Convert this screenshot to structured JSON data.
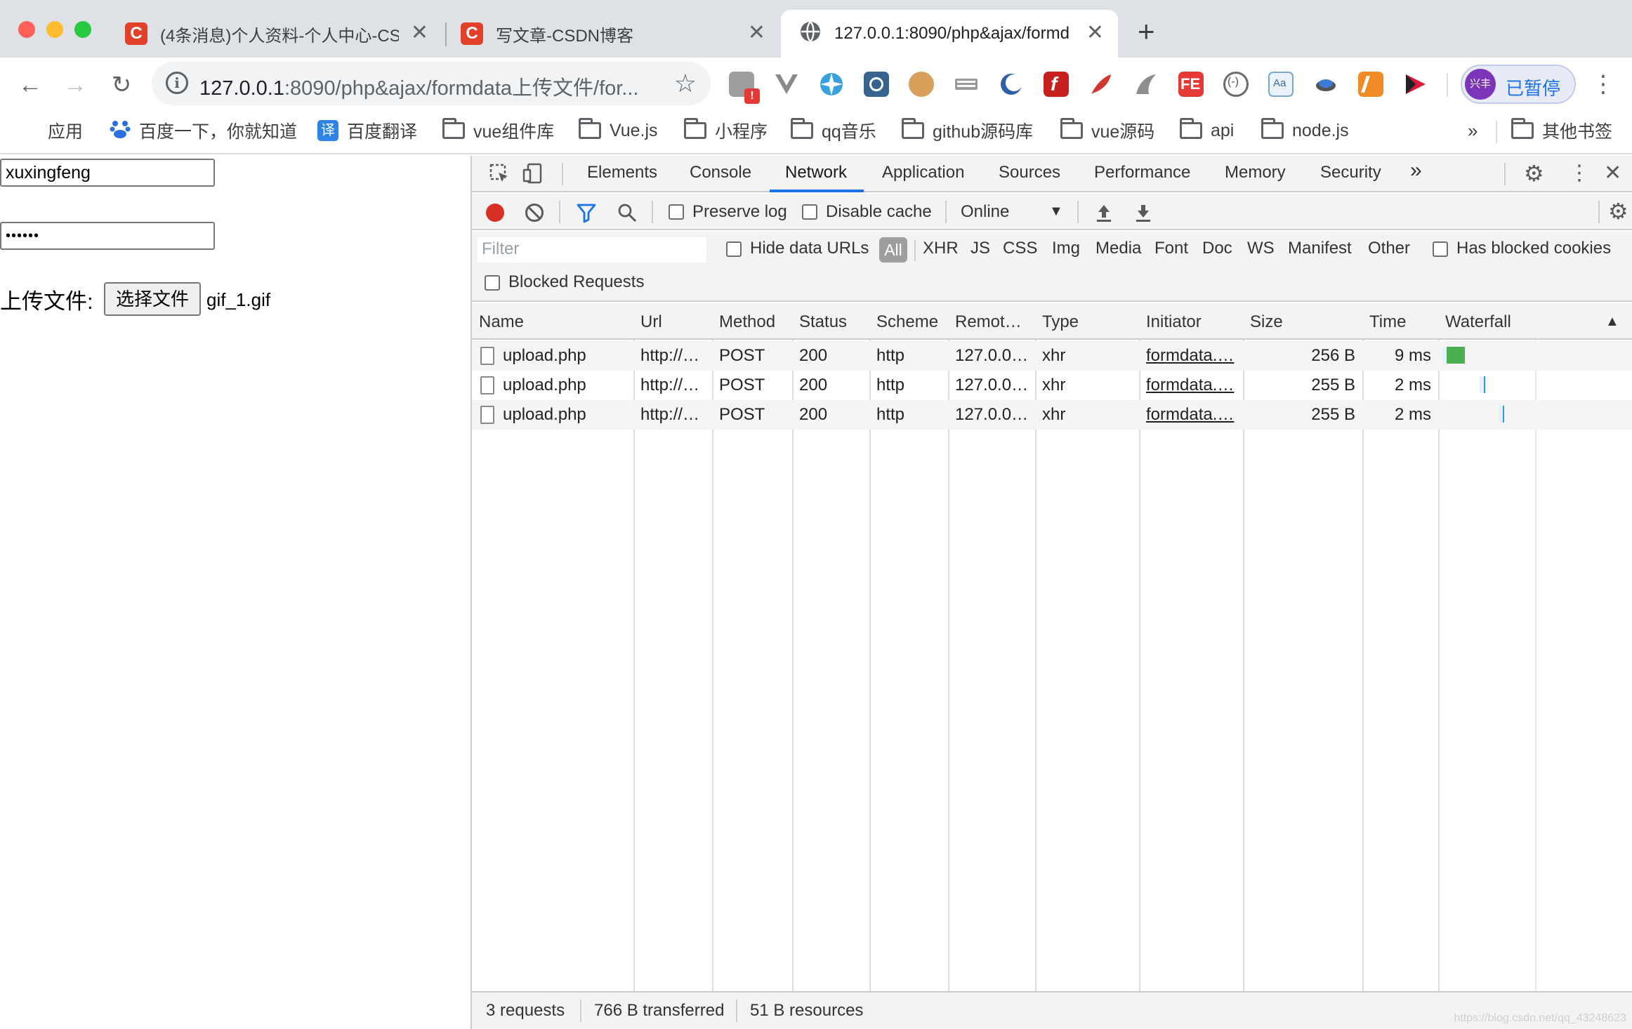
{
  "browser": {
    "tabs": [
      {
        "title": "(4条消息)个人资料-个人中心-CS",
        "favicon": "C",
        "active": false
      },
      {
        "title": "写文章-CSDN博客",
        "favicon": "C",
        "active": false
      },
      {
        "title": "127.0.0.1:8090/php&ajax/formd",
        "favicon": "globe",
        "active": true
      }
    ],
    "close_glyph": "✕",
    "new_tab_glyph": "+",
    "url_host": "127.0.0.1",
    "url_rest": ":8090/php&ajax/formdata上传文件/for...",
    "profile_avatar": "兴丰",
    "profile_label": "已暂停",
    "colors": {
      "accent": "#1a73e8",
      "record": "#d93025",
      "csdn": "#e3402a"
    }
  },
  "bookmarks": [
    {
      "label": "应用",
      "icon": "apps-grid-icon"
    },
    {
      "label": "百度一下，你就知道",
      "icon": "baidu-icon"
    },
    {
      "label": "百度翻译",
      "icon": "translate-icon"
    },
    {
      "label": "vue组件库",
      "icon": "folder-icon"
    },
    {
      "label": "Vue.js",
      "icon": "folder-icon"
    },
    {
      "label": "小程序",
      "icon": "folder-icon"
    },
    {
      "label": "qq音乐",
      "icon": "folder-icon"
    },
    {
      "label": "github源码库",
      "icon": "folder-icon"
    },
    {
      "label": "vue源码",
      "icon": "folder-icon"
    },
    {
      "label": "api",
      "icon": "folder-icon"
    },
    {
      "label": "node.js",
      "icon": "folder-icon"
    },
    {
      "label": "其他书签",
      "icon": "folder-icon"
    }
  ],
  "bookmarks_more": "»",
  "page": {
    "username_value": "xuxingfeng",
    "password_mask": "••••••",
    "upload_label": "上传文件:",
    "choose_file_button": "选择文件",
    "file_name": "gif_1.gif"
  },
  "devtools": {
    "panels": [
      "Elements",
      "Console",
      "Network",
      "Application",
      "Sources",
      "Performance",
      "Memory",
      "Security"
    ],
    "active_panel": "Network",
    "more_panels": "»",
    "toolbar": {
      "preserve_log": "Preserve log",
      "disable_cache": "Disable cache",
      "throttling": "Online"
    },
    "filter": {
      "placeholder": "Filter",
      "hide_data_urls": "Hide data URLs",
      "types": [
        "All",
        "XHR",
        "JS",
        "CSS",
        "Img",
        "Media",
        "Font",
        "Doc",
        "WS",
        "Manifest",
        "Other"
      ],
      "active_type": "All",
      "has_blocked_cookies": "Has blocked cookies",
      "blocked_requests": "Blocked Requests"
    },
    "columns": [
      "Name",
      "Url",
      "Method",
      "Status",
      "Scheme",
      "Remot…",
      "Type",
      "Initiator",
      "Size",
      "Time",
      "Waterfall"
    ],
    "sort_indicator": "▲",
    "rows": [
      {
        "name": "upload.php",
        "url": "http://…",
        "method": "POST",
        "status": "200",
        "scheme": "http",
        "remote": "127.0.0…",
        "type": "xhr",
        "initiator": "formdata.…",
        "size": "256 B",
        "time": "9 ms",
        "waterfall_start": 0.0,
        "waterfall_len": 0.12,
        "waterfall_color": "#4caf50"
      },
      {
        "name": "upload.php",
        "url": "http://…",
        "method": "POST",
        "status": "200",
        "scheme": "http",
        "remote": "127.0.0…",
        "type": "xhr",
        "initiator": "formdata.…",
        "size": "255 B",
        "time": "2 ms",
        "waterfall_start": 0.2,
        "waterfall_len": 0.03,
        "waterfall_color": "#2e9be0"
      },
      {
        "name": "upload.php",
        "url": "http://…",
        "method": "POST",
        "status": "200",
        "scheme": "http",
        "remote": "127.0.0…",
        "type": "xhr",
        "initiator": "formdata.…",
        "size": "255 B",
        "time": "2 ms",
        "waterfall_start": 0.3,
        "waterfall_len": 0.03,
        "waterfall_color": "#2e9be0"
      }
    ],
    "status_bar": {
      "requests": "3 requests",
      "transferred": "766 B transferred",
      "resources": "51 B resources"
    },
    "watermark": "https://blog.csdn.net/qq_43248623"
  }
}
